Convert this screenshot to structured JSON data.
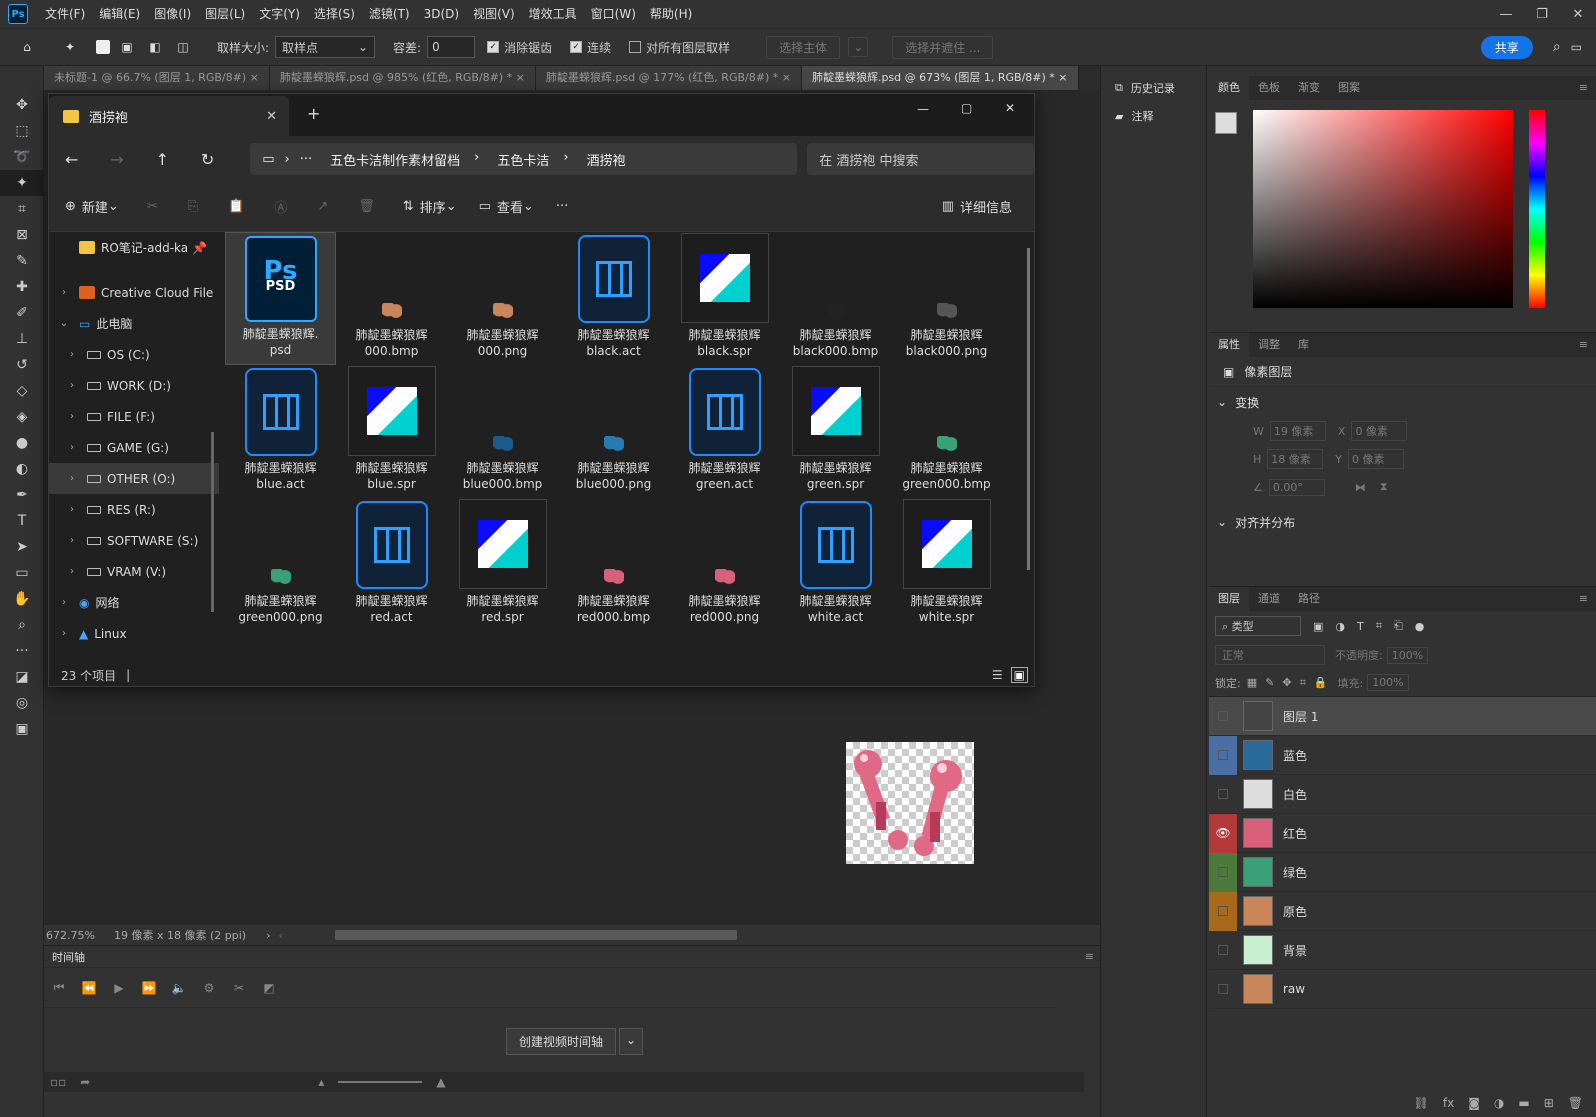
{
  "menu": {
    "logo": "Ps",
    "items": [
      "文件(F)",
      "编辑(E)",
      "图像(I)",
      "图层(L)",
      "文字(Y)",
      "选择(S)",
      "滤镜(T)",
      "3D(D)",
      "视图(V)",
      "增效工具",
      "窗口(W)",
      "帮助(H)"
    ]
  },
  "options": {
    "sample_size_label": "取样大小:",
    "sample_size_value": "取样点",
    "tolerance_label": "容差:",
    "tolerance_value": "0",
    "antialias": "消除锯齿",
    "contiguous": "连续",
    "all_layers": "对所有图层取样",
    "select_subject": "选择主体",
    "select_mask": "选择并遮住 ...",
    "share": "共享"
  },
  "tabs": [
    "未标题-1 @ 66.7% (图层 1, RGB/8#) ×",
    "肺靛墨蝾狼辉.psd @ 985% (红色, RGB/8#) * ×",
    "肺靛墨蝾狼辉.psd @ 177% (红色, RGB/8#) * ×",
    "肺靛墨蝾狼辉.psd @ 673% (图层 1, RGB/8#) * ×"
  ],
  "explorer": {
    "tab_title": "酒捞袍",
    "new_tab": "+",
    "breadcrumb": [
      "五色卡洁制作素材留档",
      "五色卡洁",
      "酒捞袍"
    ],
    "ellipsis": "···",
    "search_placeholder": "在 酒捞袍 中搜索",
    "cmd": {
      "new": "新建",
      "sort": "排序",
      "view": "查看",
      "more": "···",
      "details": "详细信息"
    },
    "nav": [
      {
        "label": "RO笔记-add-ka",
        "indent": 1
      },
      {
        "label": "Creative Cloud File",
        "indent": 1
      },
      {
        "label": "此电脑",
        "indent": 1
      },
      {
        "label": "OS (C:)",
        "indent": 2
      },
      {
        "label": "WORK (D:)",
        "indent": 2
      },
      {
        "label": "FILE (F:)",
        "indent": 2
      },
      {
        "label": "GAME (G:)",
        "indent": 2
      },
      {
        "label": "OTHER (O:)",
        "indent": 2
      },
      {
        "label": "RES (R:)",
        "indent": 2
      },
      {
        "label": "SOFTWARE (S:)",
        "indent": 2
      },
      {
        "label": "VRAM (V:)",
        "indent": 2
      },
      {
        "label": "网络",
        "indent": 1
      },
      {
        "label": "Linux",
        "indent": 1
      }
    ],
    "files": [
      {
        "l1": "肺靛墨蝾狼辉.",
        "l2": "psd",
        "type": "psd"
      },
      {
        "l1": "肺靛墨蝾狼辉",
        "l2": "000.bmp",
        "type": "sm",
        "color": "#c9865a"
      },
      {
        "l1": "肺靛墨蝾狼辉",
        "l2": "000.png",
        "type": "sm",
        "color": "#c9865a"
      },
      {
        "l1": "肺靛墨蝾狼辉",
        "l2": "black.act",
        "type": "act"
      },
      {
        "l1": "肺靛墨蝾狼辉",
        "l2": "black.spr",
        "type": "spr"
      },
      {
        "l1": "肺靛墨蝾狼辉",
        "l2": "black000.bmp",
        "type": "sm",
        "color": "#222"
      },
      {
        "l1": "肺靛墨蝾狼辉",
        "l2": "black000.png",
        "type": "sm",
        "color": "#555"
      },
      {
        "l1": "肺靛墨蝾狼辉",
        "l2": "blue.act",
        "type": "act"
      },
      {
        "l1": "肺靛墨蝾狼辉",
        "l2": "blue.spr",
        "type": "spr"
      },
      {
        "l1": "肺靛墨蝾狼辉",
        "l2": "blue000.bmp",
        "type": "sm",
        "color": "#1c5a8a"
      },
      {
        "l1": "肺靛墨蝾狼辉",
        "l2": "blue000.png",
        "type": "sm",
        "color": "#2a7ab0"
      },
      {
        "l1": "肺靛墨蝾狼辉",
        "l2": "green.act",
        "type": "act"
      },
      {
        "l1": "肺靛墨蝾狼辉",
        "l2": "green.spr",
        "type": "spr"
      },
      {
        "l1": "肺靛墨蝾狼辉",
        "l2": "green000.bmp",
        "type": "sm",
        "color": "#3aa07a"
      },
      {
        "l1": "肺靛墨蝾狼辉",
        "l2": "green000.png",
        "type": "sm",
        "color": "#3aa07a"
      },
      {
        "l1": "肺靛墨蝾狼辉",
        "l2": "red.act",
        "type": "act"
      },
      {
        "l1": "肺靛墨蝾狼辉",
        "l2": "red.spr",
        "type": "spr"
      },
      {
        "l1": "肺靛墨蝾狼辉",
        "l2": "red000.bmp",
        "type": "sm",
        "color": "#d8607a"
      },
      {
        "l1": "肺靛墨蝾狼辉",
        "l2": "red000.png",
        "type": "sm",
        "color": "#d8607a"
      },
      {
        "l1": "肺靛墨蝾狼辉",
        "l2": "white.act",
        "type": "act"
      },
      {
        "l1": "肺靛墨蝾狼辉",
        "l2": "white.spr",
        "type": "spr"
      }
    ],
    "status": "23 个项目"
  },
  "status": {
    "zoom": "672.75%",
    "size": "19 像素 x 18 像素 (2 ppi)"
  },
  "timeline": {
    "title": "时间轴",
    "create": "创建视频时间轴"
  },
  "right": {
    "history": "历史记录",
    "notes": "注释",
    "color_tabs": [
      "颜色",
      "色板",
      "渐变",
      "图案"
    ],
    "prop_tabs": [
      "属性",
      "调整",
      "库"
    ],
    "pixel_layer": "像素图层",
    "transform": "变换",
    "w_label": "W",
    "w_val": "19 像素",
    "x_label": "X",
    "x_val": "0 像素",
    "h_label": "H",
    "h_val": "18 像素",
    "y_label": "Y",
    "y_val": "0 像素",
    "angle": "0.00°",
    "align": "对齐并分布",
    "layer_tabs": [
      "图层",
      "通道",
      "路径"
    ],
    "kind": "类型",
    "blend": "正常",
    "opacity_label": "不透明度:",
    "opacity": "100%",
    "lock_label": "锁定:",
    "fill_label": "填充:",
    "fill": "100%",
    "layers": [
      {
        "name": "图层 1",
        "color": "",
        "thumb": "#444",
        "visible": false,
        "selected": true
      },
      {
        "name": "蓝色",
        "color": "#4a6fa5",
        "thumb": "#2a6a9a",
        "visible": false
      },
      {
        "name": "白色",
        "color": "",
        "thumb": "#ddd",
        "visible": false
      },
      {
        "name": "红色",
        "color": "#b33a3a",
        "thumb": "#d8607a",
        "visible": true
      },
      {
        "name": "绿色",
        "color": "#4b7a3a",
        "thumb": "#3aa07a",
        "visible": false
      },
      {
        "name": "原色",
        "color": "#a86a1a",
        "thumb": "#c9865a",
        "visible": false
      },
      {
        "name": "背景",
        "color": "",
        "thumb": "#c8f0d0",
        "visible": false
      },
      {
        "name": "raw",
        "color": "",
        "thumb": "#c9865a",
        "visible": false
      }
    ]
  }
}
